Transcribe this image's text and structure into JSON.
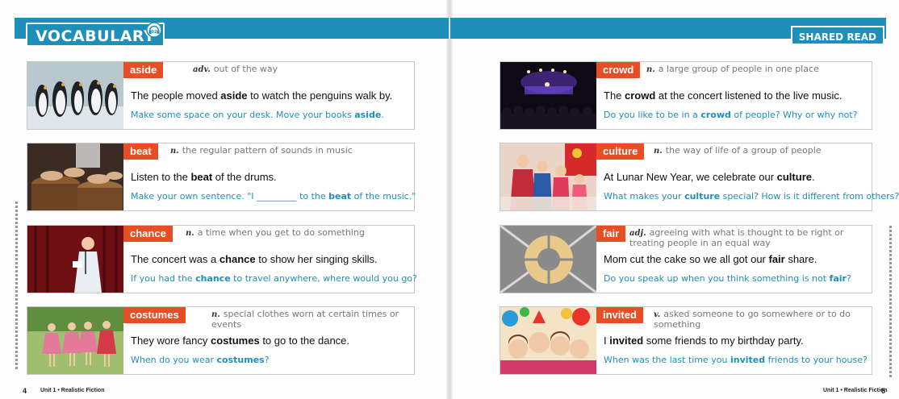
{
  "header": {
    "left_title": "VOCABULARY",
    "audio_badge": "02",
    "right_title": "SHARED READ"
  },
  "left_cards": [
    {
      "word": "aside",
      "pos": "adv.",
      "definition": "out of the way",
      "s1": "The people moved ",
      "s_bold": "aside",
      "s2": " to watch the penguins walk by.",
      "p1": "Make some space on your desk. Move your books ",
      "p_bold": "aside",
      "p2": ".",
      "photo": "penguins"
    },
    {
      "word": "beat",
      "pos": "n.",
      "definition": "the regular pattern of sounds in music",
      "s1": "Listen to the ",
      "s_bold": "beat",
      "s2": " of the drums.",
      "p1": "Make your own sentence. \"I _________ to the ",
      "p_bold": "beat",
      "p2": " of the music.\"",
      "photo": "drums"
    },
    {
      "word": "chance",
      "pos": "n.",
      "definition": "a time when you get to do something",
      "s1": "The concert was a ",
      "s_bold": "chance",
      "s2": " to show her singing skills.",
      "p1": "If you had the ",
      "p_bold": "chance",
      "p2": " to travel anywhere, where would you go?",
      "photo": "singer"
    },
    {
      "word": "costumes",
      "pos": "n.",
      "definition": "special clothes worn at certain times or events",
      "s1": "They wore fancy ",
      "s_bold": "costumes",
      "s2": " to go to the dance.",
      "p1": "When do you wear ",
      "p_bold": "costumes",
      "p2": "?",
      "photo": "dancers"
    }
  ],
  "right_cards": [
    {
      "word": "crowd",
      "pos": "n.",
      "definition": "a large group of people in one place",
      "s1": "The ",
      "s_bold": "crowd",
      "s2": " at the concert listened to the live music.",
      "p1": "Do you like to be in a ",
      "p_bold": "crowd",
      "p2": " of people? Why or why not?",
      "photo": "concert"
    },
    {
      "word": "culture",
      "pos": "n.",
      "definition": "the way of life of a group of people",
      "s1": "At Lunar New Year, we celebrate our ",
      "s_bold": "culture",
      "s2": ".",
      "p1": "What makes your ",
      "p_bold": "culture",
      "p2": " special? How is it different from others?",
      "photo": "family"
    },
    {
      "word": "fair",
      "pos": "adj.",
      "definition": "agreeing with what is thought to be right or treating people in an equal way",
      "s1": "Mom cut the cake so we all got our ",
      "s_bold": "fair",
      "s2": " share.",
      "p1": "Do you speak up when you think something is not ",
      "p_bold": "fair",
      "p2": "?",
      "photo": "cake"
    },
    {
      "word": "invited",
      "pos": "v.",
      "definition": "asked someone to go somewhere or to do something",
      "s1": "I ",
      "s_bold": "invited",
      "s2": " some friends to my birthday party.",
      "p1": "When was the last time you ",
      "p_bold": "invited",
      "p2": " friends to your house?",
      "photo": "party"
    }
  ],
  "footer": {
    "left_page": "4",
    "right_page": "5",
    "left_unit": "Unit 1 • Realistic Fiction",
    "right_unit": "Unit 1 • Realistic Fiction"
  },
  "colors": {
    "banner": "#1d8fb9",
    "word_tag": "#e84e24",
    "prompt": "#1d8fb9"
  }
}
